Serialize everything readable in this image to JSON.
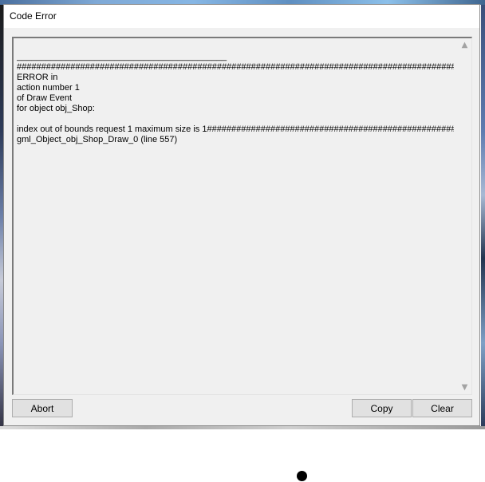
{
  "window": {
    "title": "Code Error"
  },
  "error_log": {
    "text": "___________________________________________\n############################################################################################\nERROR in\naction number 1\nof Draw Event\nfor object obj_Shop:\n\nindex out of bounds request 1 maximum size is 1############################################################################################\ngml_Object_obj_Shop_Draw_0 (line 557)"
  },
  "scrollbar": {
    "up_icon": "chevron-up-icon",
    "down_icon": "chevron-down-icon"
  },
  "buttons": {
    "abort": "Abort",
    "copy": "Copy",
    "clear": "Clear"
  }
}
